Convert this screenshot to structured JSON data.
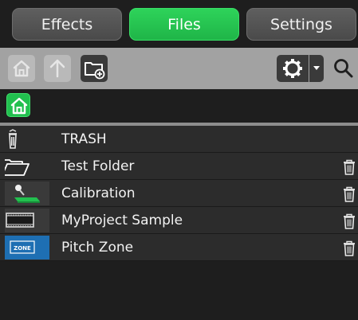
{
  "tabs": {
    "effects": "Effects",
    "files": "Files",
    "settings": "Settings",
    "active": "files",
    "active_color": "#22c04f"
  },
  "toolbar": {
    "home_icon": "home-icon",
    "up_icon": "up-arrow-icon",
    "new_folder_icon": "new-folder-icon",
    "settings_icon": "gear-icon",
    "dropdown_icon": "caret-down-icon",
    "search_icon": "search-icon"
  },
  "breadcrumb": {
    "home_icon": "home-icon"
  },
  "files": [
    {
      "label": "TRASH",
      "icon": "trash-can-icon",
      "deletable": false
    },
    {
      "label": "Test Folder",
      "icon": "folder-icon",
      "deletable": true
    },
    {
      "label": "Calibration",
      "icon": "calibration-icon",
      "deletable": true
    },
    {
      "label": "MyProject Sample",
      "icon": "sample-icon",
      "deletable": true
    },
    {
      "label": "Pitch Zone",
      "icon": "zone-icon",
      "deletable": true
    }
  ],
  "zone_icon_text": "ZONE",
  "row_delete_icon": "trash-icon"
}
